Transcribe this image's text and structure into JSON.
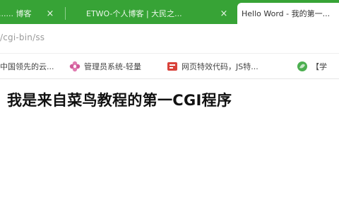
{
  "tabs": [
    {
      "title": "...... 博客",
      "active": false,
      "close_glyph": "×"
    },
    {
      "title": "ETWO-个人博客 | 大民之...",
      "active": false,
      "close_glyph": "×"
    },
    {
      "title": "Hello Word - 我的第一...",
      "active": true,
      "close_glyph": "×"
    }
  ],
  "address": {
    "url": "/cgi-bin/ss"
  },
  "bookmarks": [
    {
      "label": "中国领先的云...",
      "icon": "cloud-icon"
    },
    {
      "label": "管理员系统-轻量",
      "icon": "flower-icon"
    },
    {
      "label": "网页特效代码，JS特...",
      "icon": "bookmark-red-icon"
    },
    {
      "label": "【学",
      "icon": "leaf-icon"
    }
  ],
  "page": {
    "heading": "我是来自菜鸟教程的第一CGI程序"
  },
  "colors": {
    "tabstrip": "#37a336",
    "active_tab": "#ffffff",
    "heading_text": "#111111",
    "url_text": "#9a9a9a"
  }
}
